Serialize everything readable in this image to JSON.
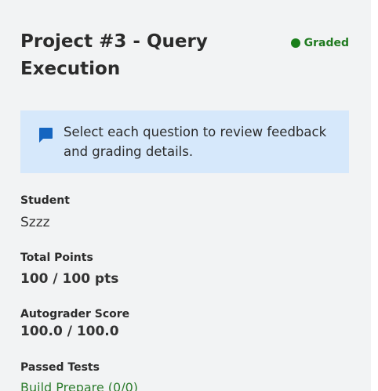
{
  "header": {
    "title": "Project #3 - Query Execution",
    "status": "Graded"
  },
  "notice": {
    "icon": "comment-icon",
    "text": "Select each question to review feedback and grading details."
  },
  "details": {
    "student_label": "Student",
    "student_value": "Szzz",
    "total_points_label": "Total Points",
    "total_points_value": "100 / 100 pts",
    "autograder_label": "Autograder Score",
    "autograder_value": "100.0 / 100.0",
    "passed_tests_label": "Passed Tests",
    "passed_tests": [
      "Build Prepare (0/0)"
    ]
  },
  "colors": {
    "panel_bg": "#f2f3f4",
    "notice_bg": "#d6e8fb",
    "status_green": "#1a7f1a",
    "icon_blue": "#1565c0",
    "link_green": "#2f7d2f"
  }
}
